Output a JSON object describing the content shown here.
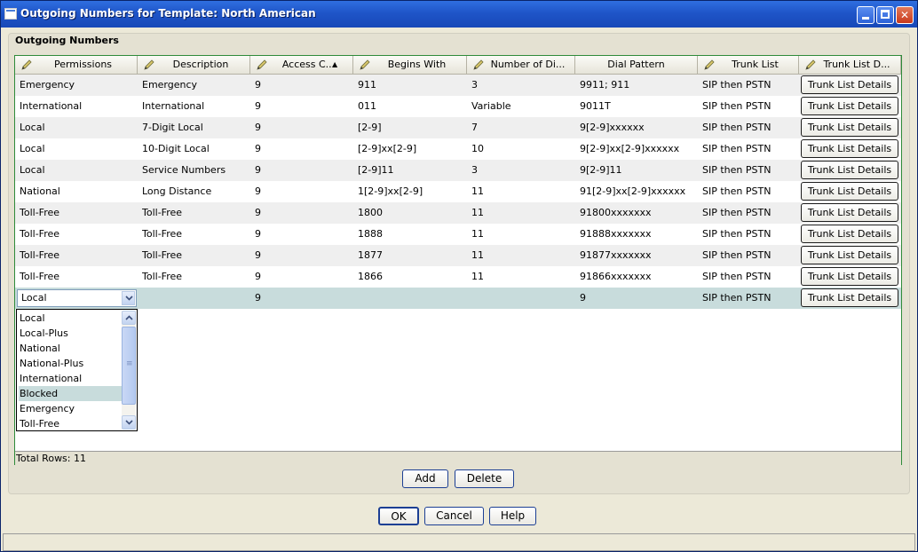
{
  "window": {
    "title": "Outgoing Numbers for Template: North American"
  },
  "panel": {
    "title": "Outgoing Numbers"
  },
  "columns": [
    {
      "label": "Permissions",
      "editable": true
    },
    {
      "label": "Description",
      "editable": true
    },
    {
      "label": "Access C...",
      "editable": true,
      "sorted": "ascending"
    },
    {
      "label": "Begins With",
      "editable": true
    },
    {
      "label": "Number of Di...",
      "editable": true
    },
    {
      "label": "Dial Pattern",
      "editable": false
    },
    {
      "label": "Trunk List",
      "editable": true
    },
    {
      "label": "Trunk List D...",
      "editable": true
    }
  ],
  "rows": [
    {
      "permissions": "Emergency",
      "description": "Emergency",
      "access_code": "9",
      "begins_with": "911",
      "num_digits": "3",
      "dial_pattern": "9911; 911",
      "trunk_list": "SIP then PSTN",
      "details_label": "Trunk List Details"
    },
    {
      "permissions": "International",
      "description": "International",
      "access_code": "9",
      "begins_with": "011",
      "num_digits": "Variable",
      "dial_pattern": "9011T",
      "trunk_list": "SIP then PSTN",
      "details_label": "Trunk List Details"
    },
    {
      "permissions": "Local",
      "description": "7-Digit Local",
      "access_code": "9",
      "begins_with": "[2-9]",
      "num_digits": "7",
      "dial_pattern": "9[2-9]xxxxxx",
      "trunk_list": "SIP then PSTN",
      "details_label": "Trunk List Details"
    },
    {
      "permissions": "Local",
      "description": "10-Digit Local",
      "access_code": "9",
      "begins_with": "[2-9]xx[2-9]",
      "num_digits": "10",
      "dial_pattern": "9[2-9]xx[2-9]xxxxxx",
      "trunk_list": "SIP then PSTN",
      "details_label": "Trunk List Details"
    },
    {
      "permissions": "Local",
      "description": "Service Numbers",
      "access_code": "9",
      "begins_with": "[2-9]11",
      "num_digits": "3",
      "dial_pattern": "9[2-9]11",
      "trunk_list": "SIP then PSTN",
      "details_label": "Trunk List Details"
    },
    {
      "permissions": "National",
      "description": "Long Distance",
      "access_code": "9",
      "begins_with": "1[2-9]xx[2-9]",
      "num_digits": "11",
      "dial_pattern": "91[2-9]xx[2-9]xxxxxx",
      "trunk_list": "SIP then PSTN",
      "details_label": "Trunk List Details"
    },
    {
      "permissions": "Toll-Free",
      "description": "Toll-Free",
      "access_code": "9",
      "begins_with": "1800",
      "num_digits": "11",
      "dial_pattern": "91800xxxxxxx",
      "trunk_list": "SIP then PSTN",
      "details_label": "Trunk List Details"
    },
    {
      "permissions": "Toll-Free",
      "description": "Toll-Free",
      "access_code": "9",
      "begins_with": "1888",
      "num_digits": "11",
      "dial_pattern": "91888xxxxxxx",
      "trunk_list": "SIP then PSTN",
      "details_label": "Trunk List Details"
    },
    {
      "permissions": "Toll-Free",
      "description": "Toll-Free",
      "access_code": "9",
      "begins_with": "1877",
      "num_digits": "11",
      "dial_pattern": "91877xxxxxxx",
      "trunk_list": "SIP then PSTN",
      "details_label": "Trunk List Details"
    },
    {
      "permissions": "Toll-Free",
      "description": "Toll-Free",
      "access_code": "9",
      "begins_with": "1866",
      "num_digits": "11",
      "dial_pattern": "91866xxxxxxx",
      "trunk_list": "SIP then PSTN",
      "details_label": "Trunk List Details"
    },
    {
      "permissions": "Local",
      "description": "",
      "access_code": "9",
      "begins_with": "",
      "num_digits": "",
      "dial_pattern": "9",
      "trunk_list": "SIP then PSTN",
      "details_label": "Trunk List Details"
    }
  ],
  "permission_dropdown": {
    "value": "Local",
    "options": [
      "Local",
      "Local-Plus",
      "National",
      "National-Plus",
      "International",
      "Blocked",
      "Emergency",
      "Toll-Free"
    ],
    "highlighted": "Blocked"
  },
  "footer": {
    "total_rows": "Total Rows: 11"
  },
  "buttons": {
    "add": "Add",
    "delete": "Delete",
    "ok": "OK",
    "cancel": "Cancel",
    "help": "Help"
  }
}
